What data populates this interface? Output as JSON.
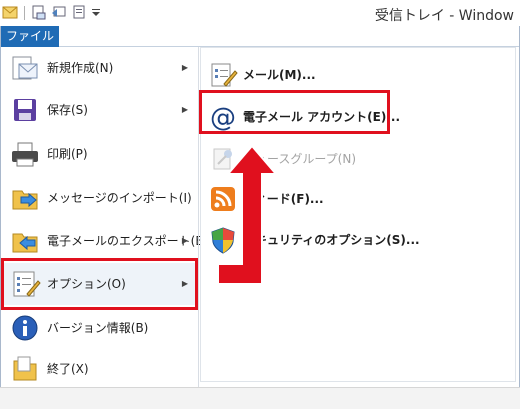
{
  "window": {
    "title": "受信トレイ - Window"
  },
  "ribbon": {
    "file_tab": "ファイル"
  },
  "left_menu": {
    "items": [
      {
        "label": "新規作成(N)",
        "icon": "new-item-icon",
        "has_submenu": true
      },
      {
        "label": "保存(S)",
        "icon": "floppy-disk-icon",
        "has_submenu": true
      },
      {
        "label": "印刷(P)",
        "icon": "printer-icon",
        "has_submenu": false
      },
      {
        "label": "メッセージのインポート(I)",
        "icon": "import-folder-icon",
        "has_submenu": false
      },
      {
        "label": "電子メールのエクスポート(E)",
        "icon": "export-folder-icon",
        "has_submenu": true
      },
      {
        "label": "オプション(O)",
        "icon": "options-icon",
        "has_submenu": true,
        "selected": true
      },
      {
        "label": "バージョン情報(B)",
        "icon": "info-icon",
        "has_submenu": false
      },
      {
        "label": "終了(X)",
        "icon": "exit-icon",
        "has_submenu": false
      }
    ]
  },
  "sub_menu": {
    "items": [
      {
        "label": "メール(M)...",
        "icon": "mail-options-icon",
        "enabled": true
      },
      {
        "label": "電子メール アカウント(E)...",
        "icon": "at-sign-icon",
        "enabled": true,
        "highlighted": true
      },
      {
        "label": "ニュースグループ(N)",
        "icon": "newsgroup-icon",
        "enabled": false
      },
      {
        "label": "フィード(F)...",
        "icon": "rss-feed-icon",
        "enabled": true
      },
      {
        "label": "セキュリティのオプション(S)...",
        "icon": "security-shield-icon",
        "enabled": true
      }
    ]
  },
  "colors": {
    "accent": "#1f6bb5",
    "highlight": "#e0101e",
    "selected_bg": "#eef3f9"
  }
}
